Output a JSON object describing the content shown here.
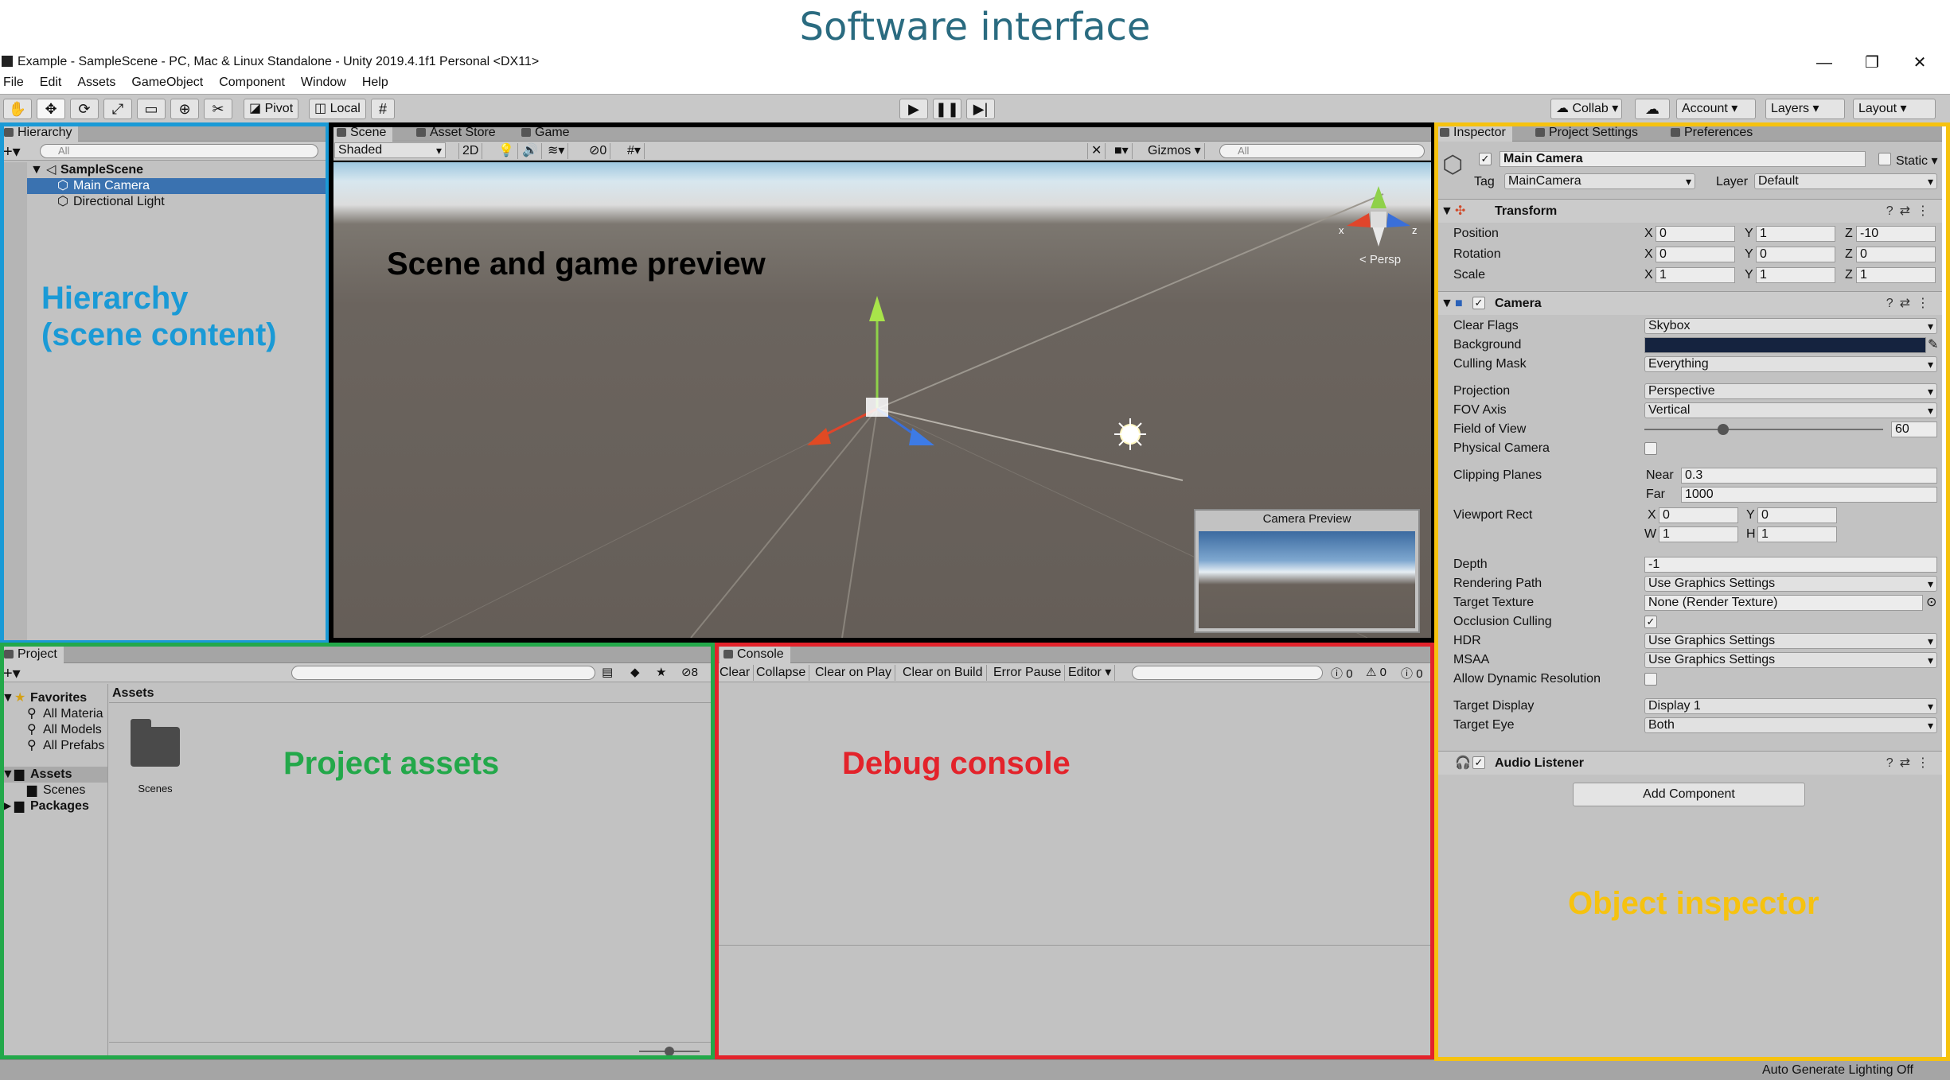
{
  "heading": "Software interface",
  "window": {
    "title": "Example - SampleScene - PC, Mac & Linux Standalone - Unity 2019.4.1f1 Personal <DX11>",
    "minimize": "—",
    "maximize": "❐",
    "close": "✕"
  },
  "menu": [
    "File",
    "Edit",
    "Assets",
    "GameObject",
    "Component",
    "Window",
    "Help"
  ],
  "toolbar": {
    "pivot": "Pivot",
    "local": "Local",
    "collab": "Collab",
    "account": "Account",
    "layers": "Layers",
    "layout": "Layout"
  },
  "hierarchy": {
    "tab": "Hierarchy",
    "search_placeholder": "All",
    "scene": "SampleScene",
    "items": [
      "Main Camera",
      "Directional Light"
    ]
  },
  "scene": {
    "tabs": [
      "Scene",
      "Asset Store",
      "Game"
    ],
    "shading": "Shaded",
    "mode_2d": "2D",
    "hidden_count": "0",
    "gizmos": "Gizmos",
    "search_placeholder": "All",
    "persp": "< Persp",
    "camera_preview": "Camera Preview"
  },
  "project": {
    "tab": "Project",
    "hidden_count": "8",
    "favorites": "Favorites",
    "favorite_items": [
      "All Materia",
      "All Models",
      "All Prefabs"
    ],
    "assets": "Assets",
    "asset_children": [
      "Scenes"
    ],
    "packages": "Packages",
    "content_header": "Assets",
    "folder_label": "Scenes"
  },
  "console": {
    "tab": "Console",
    "buttons": [
      "Clear",
      "Collapse",
      "Clear on Play",
      "Clear on Build",
      "Error Pause",
      "Editor"
    ],
    "counts": [
      "0",
      "0",
      "0"
    ]
  },
  "inspector": {
    "tabs": [
      "Inspector",
      "Project Settings",
      "Preferences"
    ],
    "object_name": "Main Camera",
    "static_label": "Static",
    "tag_label": "Tag",
    "tag_value": "MainCamera",
    "layer_label": "Layer",
    "layer_value": "Default",
    "transform": {
      "title": "Transform",
      "position_label": "Position",
      "rotation_label": "Rotation",
      "scale_label": "Scale",
      "position": {
        "x": "0",
        "y": "1",
        "z": "-10"
      },
      "rotation": {
        "x": "0",
        "y": "0",
        "z": "0"
      },
      "scale": {
        "x": "1",
        "y": "1",
        "z": "1"
      }
    },
    "camera": {
      "title": "Camera",
      "rows": [
        {
          "label": "Clear Flags",
          "value": "Skybox"
        },
        {
          "label": "Background",
          "value": ""
        },
        {
          "label": "Culling Mask",
          "value": "Everything"
        },
        {
          "label": "Projection",
          "value": "Perspective"
        },
        {
          "label": "FOV Axis",
          "value": "Vertical"
        },
        {
          "label": "Field of View",
          "value": "60"
        },
        {
          "label": "Physical Camera",
          "value": ""
        },
        {
          "label": "Clipping Planes",
          "value": ""
        },
        {
          "label": "Viewport Rect",
          "value": ""
        },
        {
          "label": "Depth",
          "value": "-1"
        },
        {
          "label": "Rendering Path",
          "value": "Use Graphics Settings"
        },
        {
          "label": "Target Texture",
          "value": "None (Render Texture)"
        },
        {
          "label": "Occlusion Culling",
          "value": ""
        },
        {
          "label": "HDR",
          "value": "Use Graphics Settings"
        },
        {
          "label": "MSAA",
          "value": "Use Graphics Settings"
        },
        {
          "label": "Allow Dynamic Resolution",
          "value": ""
        },
        {
          "label": "Target Display",
          "value": "Display 1"
        },
        {
          "label": "Target Eye",
          "value": "Both"
        }
      ],
      "fov_fraction": 0.33,
      "near_label": "Near",
      "near": "0.3",
      "far_label": "Far",
      "far": "1000",
      "viewport": {
        "x": "0",
        "y": "0",
        "w": "1",
        "h": "1"
      },
      "background_color": "#15233f"
    },
    "audio_listener": "Audio Listener",
    "add_component": "Add Component"
  },
  "status": "Auto Generate Lighting Off",
  "annotations": {
    "hierarchy": "Hierarchy\n(scene content)",
    "scene": "Scene and game preview",
    "project": "Project assets",
    "console": "Debug console",
    "inspector": "Object inspector"
  },
  "colors": {
    "hierarchy": "#1a9ad6",
    "scene": "#000000",
    "project": "#23a84a",
    "console": "#e3232b",
    "inspector": "#f6c20f"
  }
}
